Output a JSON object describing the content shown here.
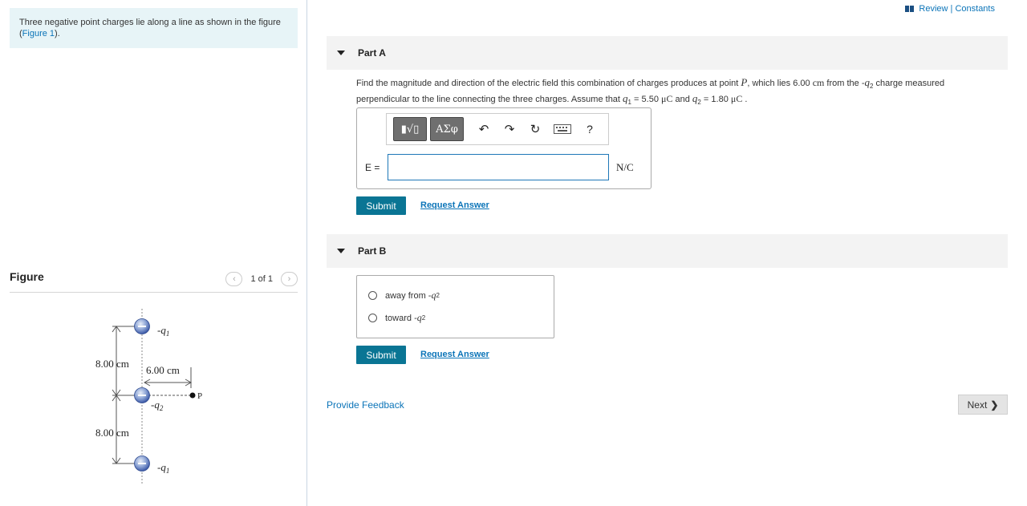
{
  "intro": {
    "text_before": "Three negative point charges lie along a line as shown in the figure (",
    "figure_link": "Figure 1",
    "text_after": ")."
  },
  "figure_panel": {
    "title": "Figure",
    "pager": "1 of 1",
    "labels": {
      "q1_top": "-q",
      "q1_top_sub": "1",
      "q2": "-q",
      "q2_sub": "2",
      "q1_bottom": "-q",
      "q1_bottom_sub": "1",
      "dist_top": "8.00 cm",
      "dist_bottom": "8.00 cm",
      "dist_horizontal": "6.00 cm",
      "point": "P"
    }
  },
  "header": {
    "review": "Review | Constants"
  },
  "part_a": {
    "label": "Part A",
    "q_1": "Find the magnitude and direction of the electric field this combination of charges produces at point ",
    "q_P": "P",
    "q_2": ", which lies 6.00 ",
    "q_cm": "cm",
    "q_3": " from the -",
    "q_q2": "q",
    "q_q2sub": "2",
    "q_4": " charge measured perpendicular to the line connecting the three charges. Assume that ",
    "q_q1": "q",
    "q_q1sub": "1",
    "q_5": " = 5.50 ",
    "q_unit1": "μC",
    "q_6": " and ",
    "q_q2b": "q",
    "q_q2bsub": "2",
    "q_7": " = 1.80 ",
    "q_unit2": "μC",
    "q_8": " .",
    "toolbar": {
      "templates": "▮√▯",
      "greek": "ΑΣφ",
      "help": "?"
    },
    "e_label": "E",
    "e_eq": " =",
    "unit": "N/C",
    "submit": "Submit",
    "request": "Request Answer"
  },
  "part_b": {
    "label": "Part B",
    "options": [
      {
        "text": "away from -",
        "q": "q",
        "sub": "2"
      },
      {
        "text": "toward -",
        "q": "q",
        "sub": "2"
      }
    ],
    "submit": "Submit",
    "request": "Request Answer"
  },
  "footer": {
    "feedback": "Provide Feedback",
    "next": "Next"
  }
}
